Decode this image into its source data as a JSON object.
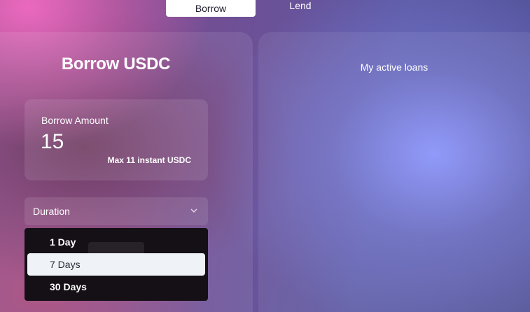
{
  "tabs": {
    "borrow_label": "Borrow",
    "lend_label": "Lend"
  },
  "borrow_panel": {
    "title": "Borrow USDC",
    "amount_label": "Borrow Amount",
    "amount_value": "15",
    "max_note": "Max 11 instant USDC"
  },
  "duration": {
    "label": "Duration",
    "icon": "chevron-down-icon",
    "options": [
      {
        "label": "1 Day"
      },
      {
        "label": "7 Days",
        "highlighted": true
      },
      {
        "label": "30 Days"
      }
    ]
  },
  "loans_panel": {
    "title": "My active loans"
  },
  "colors": {
    "highlight_option": "#eff2f7",
    "dropdown_bg": "#150f16",
    "active_tab_bg": "#ffffff"
  }
}
